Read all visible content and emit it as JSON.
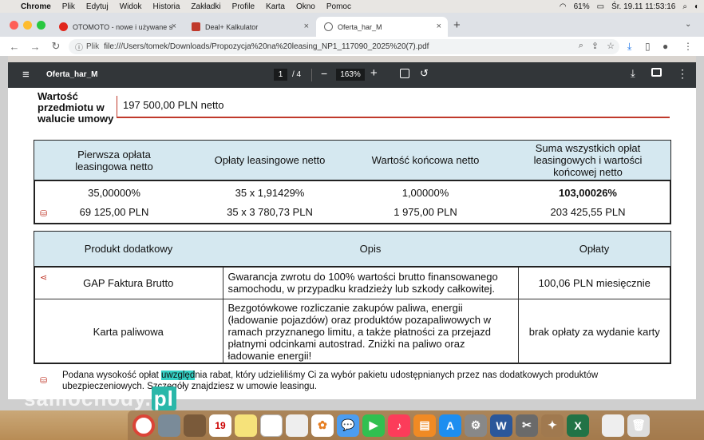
{
  "menubar": {
    "app": "Chrome",
    "items": [
      "Plik",
      "Edytuj",
      "Widok",
      "Historia",
      "Zakładki",
      "Profile",
      "Karta",
      "Okno",
      "Pomoc"
    ],
    "battery": "61%",
    "clock": "Śr. 19.11  11:53:16"
  },
  "tabs": [
    {
      "title": "OTOMOTO - nowe i używane s"
    },
    {
      "title": "Deal+ Kalkulator"
    },
    {
      "title": "Oferta_har_M"
    }
  ],
  "toolbar": {
    "scheme_label": "Plik",
    "url": "file:///Users/tomek/Downloads/Propozycja%20na%20leasing_NP1_117090_2025%20(7).pdf"
  },
  "pdf": {
    "title": "Oferta_har_M",
    "page_current": "1",
    "page_total": "/ 4",
    "zoom": "163%"
  },
  "doc": {
    "wartosc_label_1": "Wartość",
    "wartosc_label_2": "przedmiotu w",
    "wartosc_label_3": "walucie umowy",
    "wartosc_value": "197 500,00 PLN netto",
    "t1": {
      "headers": [
        [
          "Pierwsza opłata",
          "leasingowa netto"
        ],
        [
          "Opłaty leasingowe netto"
        ],
        [
          "Wartość końcowa netto"
        ],
        [
          "Suma wszystkich opłat",
          "leasingowych i wartości",
          "końcowej netto"
        ]
      ],
      "row1": [
        "35,00000%",
        "35 x 1,91429%",
        "1,00000%",
        "103,00026%"
      ],
      "row2": [
        "69 125,00 PLN",
        "35 x 3 780,73 PLN",
        "1 975,00 PLN",
        "203 425,55 PLN"
      ]
    },
    "t2": {
      "headers": [
        "Produkt dodatkowy",
        "Opis",
        "Opłaty"
      ],
      "rows": [
        {
          "product": "GAP Faktura Brutto",
          "desc": [
            "Gwarancja zwrotu do 100% wartości brutto finansowanego",
            "samochodu, w przypadku kradzieży lub szkody całkowitej."
          ],
          "fee": "100,06 PLN miesięcznie"
        },
        {
          "product": "Karta paliwowa",
          "desc": [
            "Bezgotówkowe rozliczanie zakupów paliwa, energii",
            "(ładowanie pojazdów) oraz produktów pozapaliwowych w",
            "ramach przyznanego limitu, a także płatności za przejazd",
            "płatnymi odcinkami autostrad. Zniżki na paliwo oraz",
            "ładowanie energii!"
          ],
          "fee": "brak opłaty za wydanie karty"
        }
      ]
    },
    "note_before": "Podana wysokość opłat ",
    "note_highlight": "uwzględ",
    "note_after": "nia rabat, który udzieliliśmy Ci za wybór pakietu udostępnianych przez nas dodatkowych produktów",
    "note_line2": "ubezpieczeniowych. Szczegóły znajdziesz w umowie leasingu."
  },
  "watermark": {
    "text": "samochody",
    "suffix": "pl"
  },
  "dock": {
    "calendar_day": "19"
  }
}
